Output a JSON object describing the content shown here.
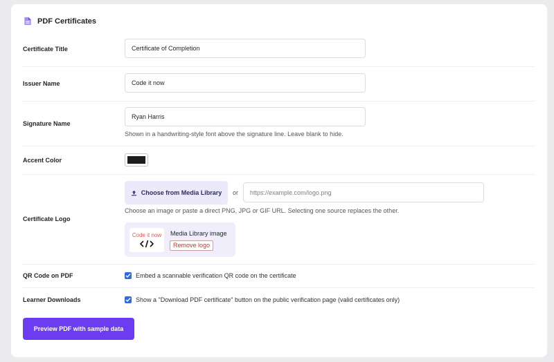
{
  "section": {
    "title": "PDF Certificates",
    "icon": "document-icon",
    "accent": "#7c5cf0"
  },
  "fields": {
    "certificate_title": {
      "label": "Certificate Title",
      "value": "Certificate of Completion"
    },
    "issuer_name": {
      "label": "Issuer Name",
      "value": "Code it now"
    },
    "signature_name": {
      "label": "Signature Name",
      "value": "Ryan Harris",
      "help": "Shown in a handwriting-style font above the signature line. Leave blank to hide."
    },
    "accent_color": {
      "label": "Accent Color",
      "value": "#1d1d1f"
    },
    "certificate_logo": {
      "label": "Certificate Logo",
      "media_button": "Choose from Media Library",
      "or": "or",
      "url_placeholder": "https://example.com/logo.png",
      "help": "Choose an image or paste a direct PNG, JPG or GIF URL. Selecting one source replaces the other.",
      "preview": {
        "brand_text": "Code it now",
        "media_label": "Media Library image",
        "remove_label": "Remove logo"
      }
    },
    "qr_code": {
      "label": "QR Code on PDF",
      "checked": true,
      "text": "Embed a scannable verification QR code on the certificate"
    },
    "learner_downloads": {
      "label": "Learner Downloads",
      "checked": true,
      "text": "Show a \"Download PDF certificate\" button on the public verification page (valid certificates only)"
    }
  },
  "actions": {
    "preview_label": "Preview PDF with sample data",
    "preview_color": "#6b3cf0"
  },
  "colors": {
    "checkbox": "#2f6be0",
    "media_button_bg": "#ece9fb",
    "logo_preview_bg": "#f1eefc",
    "remove_text": "#c0392b"
  }
}
